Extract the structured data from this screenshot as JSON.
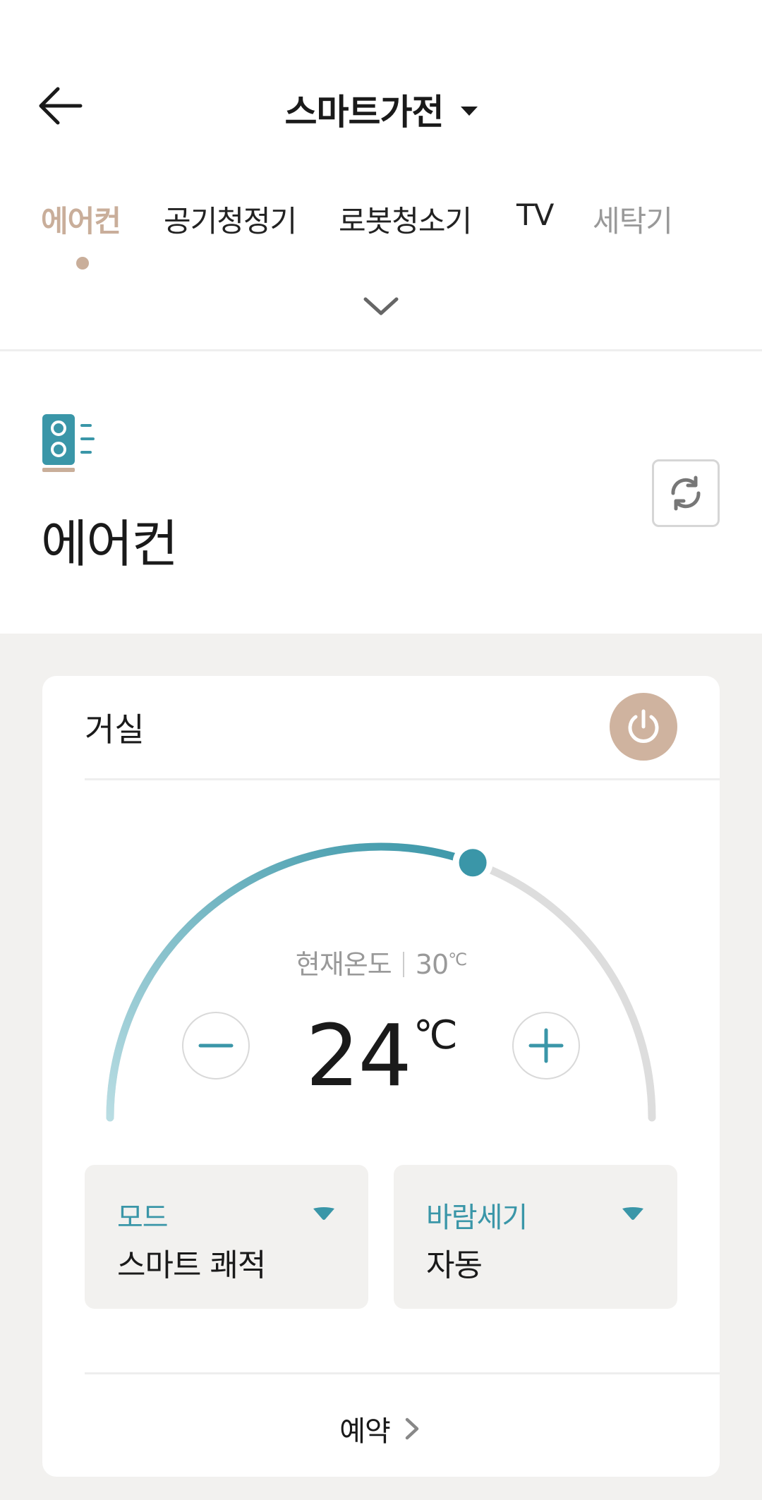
{
  "header": {
    "title": "스마트가전",
    "back_icon": "arrow-left-icon",
    "dropdown_icon": "caret-down-icon"
  },
  "tabs": [
    {
      "label": "에어컨",
      "active": true
    },
    {
      "label": "공기청정기",
      "active": false
    },
    {
      "label": "로봇청소기",
      "active": false
    },
    {
      "label": "TV",
      "active": false
    },
    {
      "label": "세탁기",
      "active": false
    }
  ],
  "expand_icon": "chevron-down-icon",
  "device": {
    "icon": "air-conditioner-icon",
    "name": "에어컨",
    "refresh_icon": "refresh-icon"
  },
  "room": {
    "name": "거실",
    "power_icon": "power-icon"
  },
  "thermostat": {
    "current_label": "현재온도",
    "current_value": "30",
    "current_unit": "℃",
    "set_value": "24",
    "set_unit": "℃",
    "set_level_fraction": 0.61,
    "minus_icon": "minus-icon",
    "plus_icon": "plus-icon"
  },
  "options": {
    "mode": {
      "label": "모드",
      "value": "스마트 쾌적"
    },
    "wind": {
      "label": "바람세기",
      "value": "자동"
    }
  },
  "reserve": {
    "label": "예약",
    "icon": "chevron-right-icon"
  },
  "colors": {
    "accent_teal": "#3a96a8",
    "accent_beige": "#c9ae9a",
    "power_bg": "#cfb39f",
    "track_gray": "#dddddd",
    "background_gray": "#f2f1ef"
  }
}
